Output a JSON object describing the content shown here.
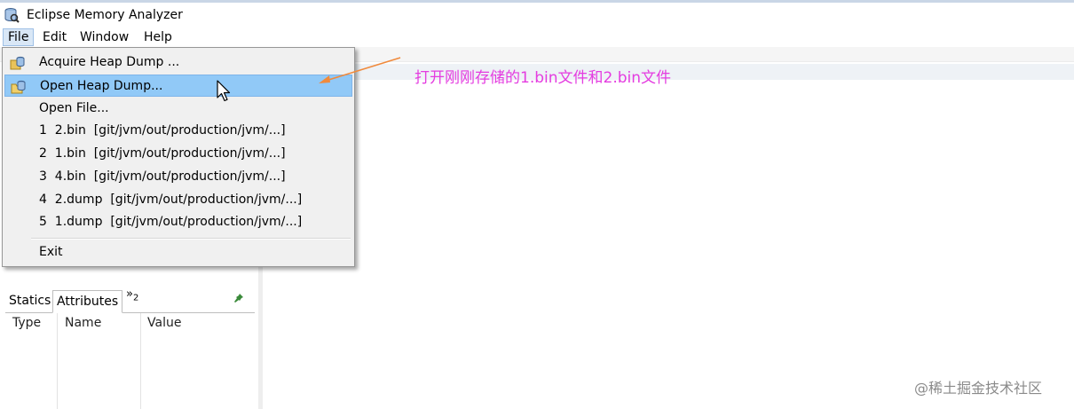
{
  "window": {
    "title": "Eclipse Memory Analyzer",
    "icon": "memory-analyzer-app-icon"
  },
  "menubar": {
    "items": [
      "File",
      "Edit",
      "Window",
      "Help"
    ],
    "active": "File"
  },
  "file_menu": {
    "items": [
      {
        "label": "Acquire Heap Dump ...",
        "icon": "acquire-heap-dump-icon"
      },
      {
        "label": "Open Heap Dump...",
        "icon": "open-heap-dump-icon",
        "highlighted": true
      },
      {
        "label": "Open File..."
      },
      {
        "label": "1  2.bin  [git/jvm/out/production/jvm/...]"
      },
      {
        "label": "2  1.bin  [git/jvm/out/production/jvm/...]"
      },
      {
        "label": "3  4.bin  [git/jvm/out/production/jvm/...]"
      },
      {
        "label": "4  2.dump  [git/jvm/out/production/jvm/...]"
      },
      {
        "label": "5  1.dump  [git/jvm/out/production/jvm/...]"
      },
      {
        "label": "Exit"
      }
    ]
  },
  "inspector": {
    "tabs": [
      "Statics",
      "Attributes"
    ],
    "selected_tab": "Attributes",
    "more_tabs": {
      "glyph": "»",
      "count": "2"
    },
    "columns": [
      "Type",
      "Name",
      "Value"
    ],
    "pin_icon": "pin-icon"
  },
  "annotation": {
    "text": "打开刚刚存储的1.bin文件和2.bin文件",
    "color": "#e43ce0"
  },
  "watermark": "@稀土掘金技术社区",
  "colors": {
    "highlight": "#91c9f7",
    "menu_bg": "#f0f0f0",
    "annotation": "#e43ce0"
  }
}
